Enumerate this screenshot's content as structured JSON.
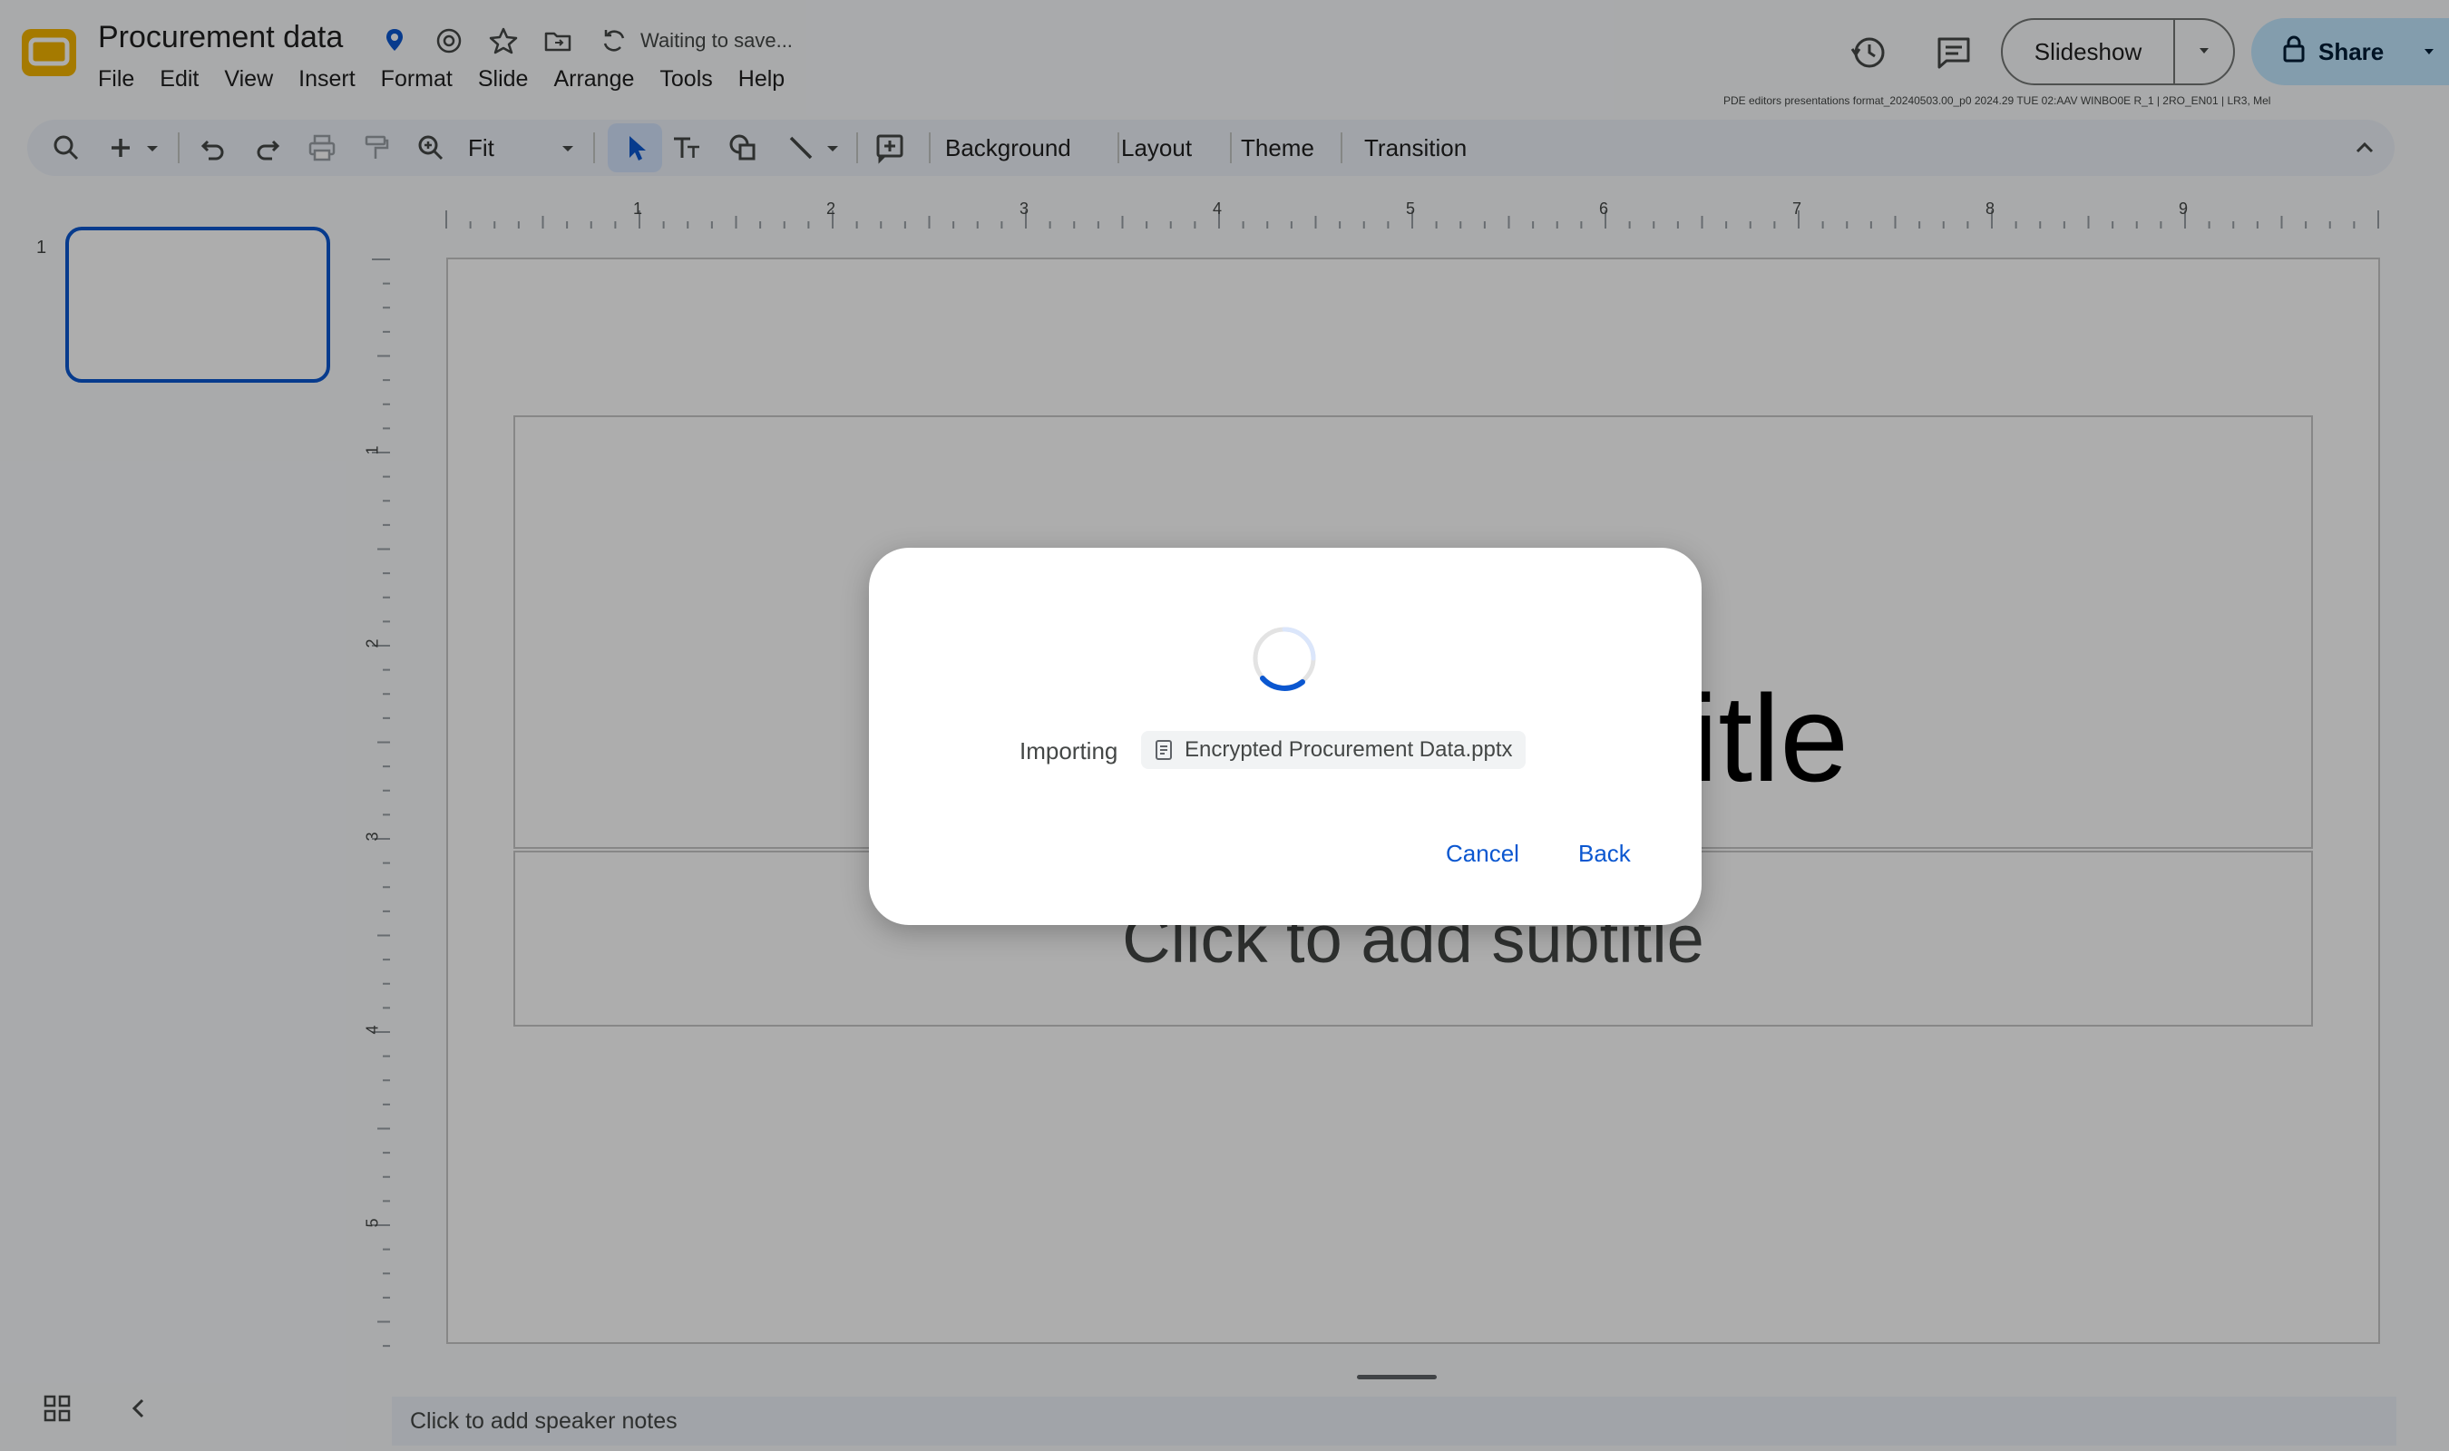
{
  "app": {
    "logo_icon": "slides-logo-icon",
    "title": "Procurement data",
    "save_status": "Waiting to save...",
    "info_line": "PDE editors presentations format_20240503.00_p0 2024.29 TUE 02:AAV WINBO0E R_1 | 2RO_EN01 | LR3, Mel",
    "accent_color": "#0b57d0",
    "logo_color": "#f4b400"
  },
  "menu": [
    "File",
    "Edit",
    "View",
    "Insert",
    "Format",
    "Slide",
    "Arrange",
    "Tools",
    "Help"
  ],
  "header_actions": {
    "slideshow_label": "Slideshow",
    "share_label": "Share"
  },
  "toolbar": {
    "zoom_label": "Fit",
    "background_label": "Background",
    "layout_label": "Layout",
    "theme_label": "Theme",
    "transition_label": "Transition"
  },
  "filmstrip": {
    "slide_number": "1"
  },
  "ruler": {
    "horizontal_labels": [
      "1",
      "2",
      "3",
      "4",
      "5",
      "6",
      "7",
      "8",
      "9"
    ],
    "vertical_labels": [
      "1",
      "2",
      "3",
      "4",
      "5"
    ]
  },
  "slide": {
    "title_placeholder": "Click to add title",
    "subtitle_placeholder": "Click to add subtitle"
  },
  "notes": {
    "placeholder": "Click to add speaker notes"
  },
  "dialog": {
    "importing_label": "Importing",
    "file_name": "Encrypted Procurement Data.pptx",
    "cancel_label": "Cancel",
    "back_label": "Back"
  }
}
